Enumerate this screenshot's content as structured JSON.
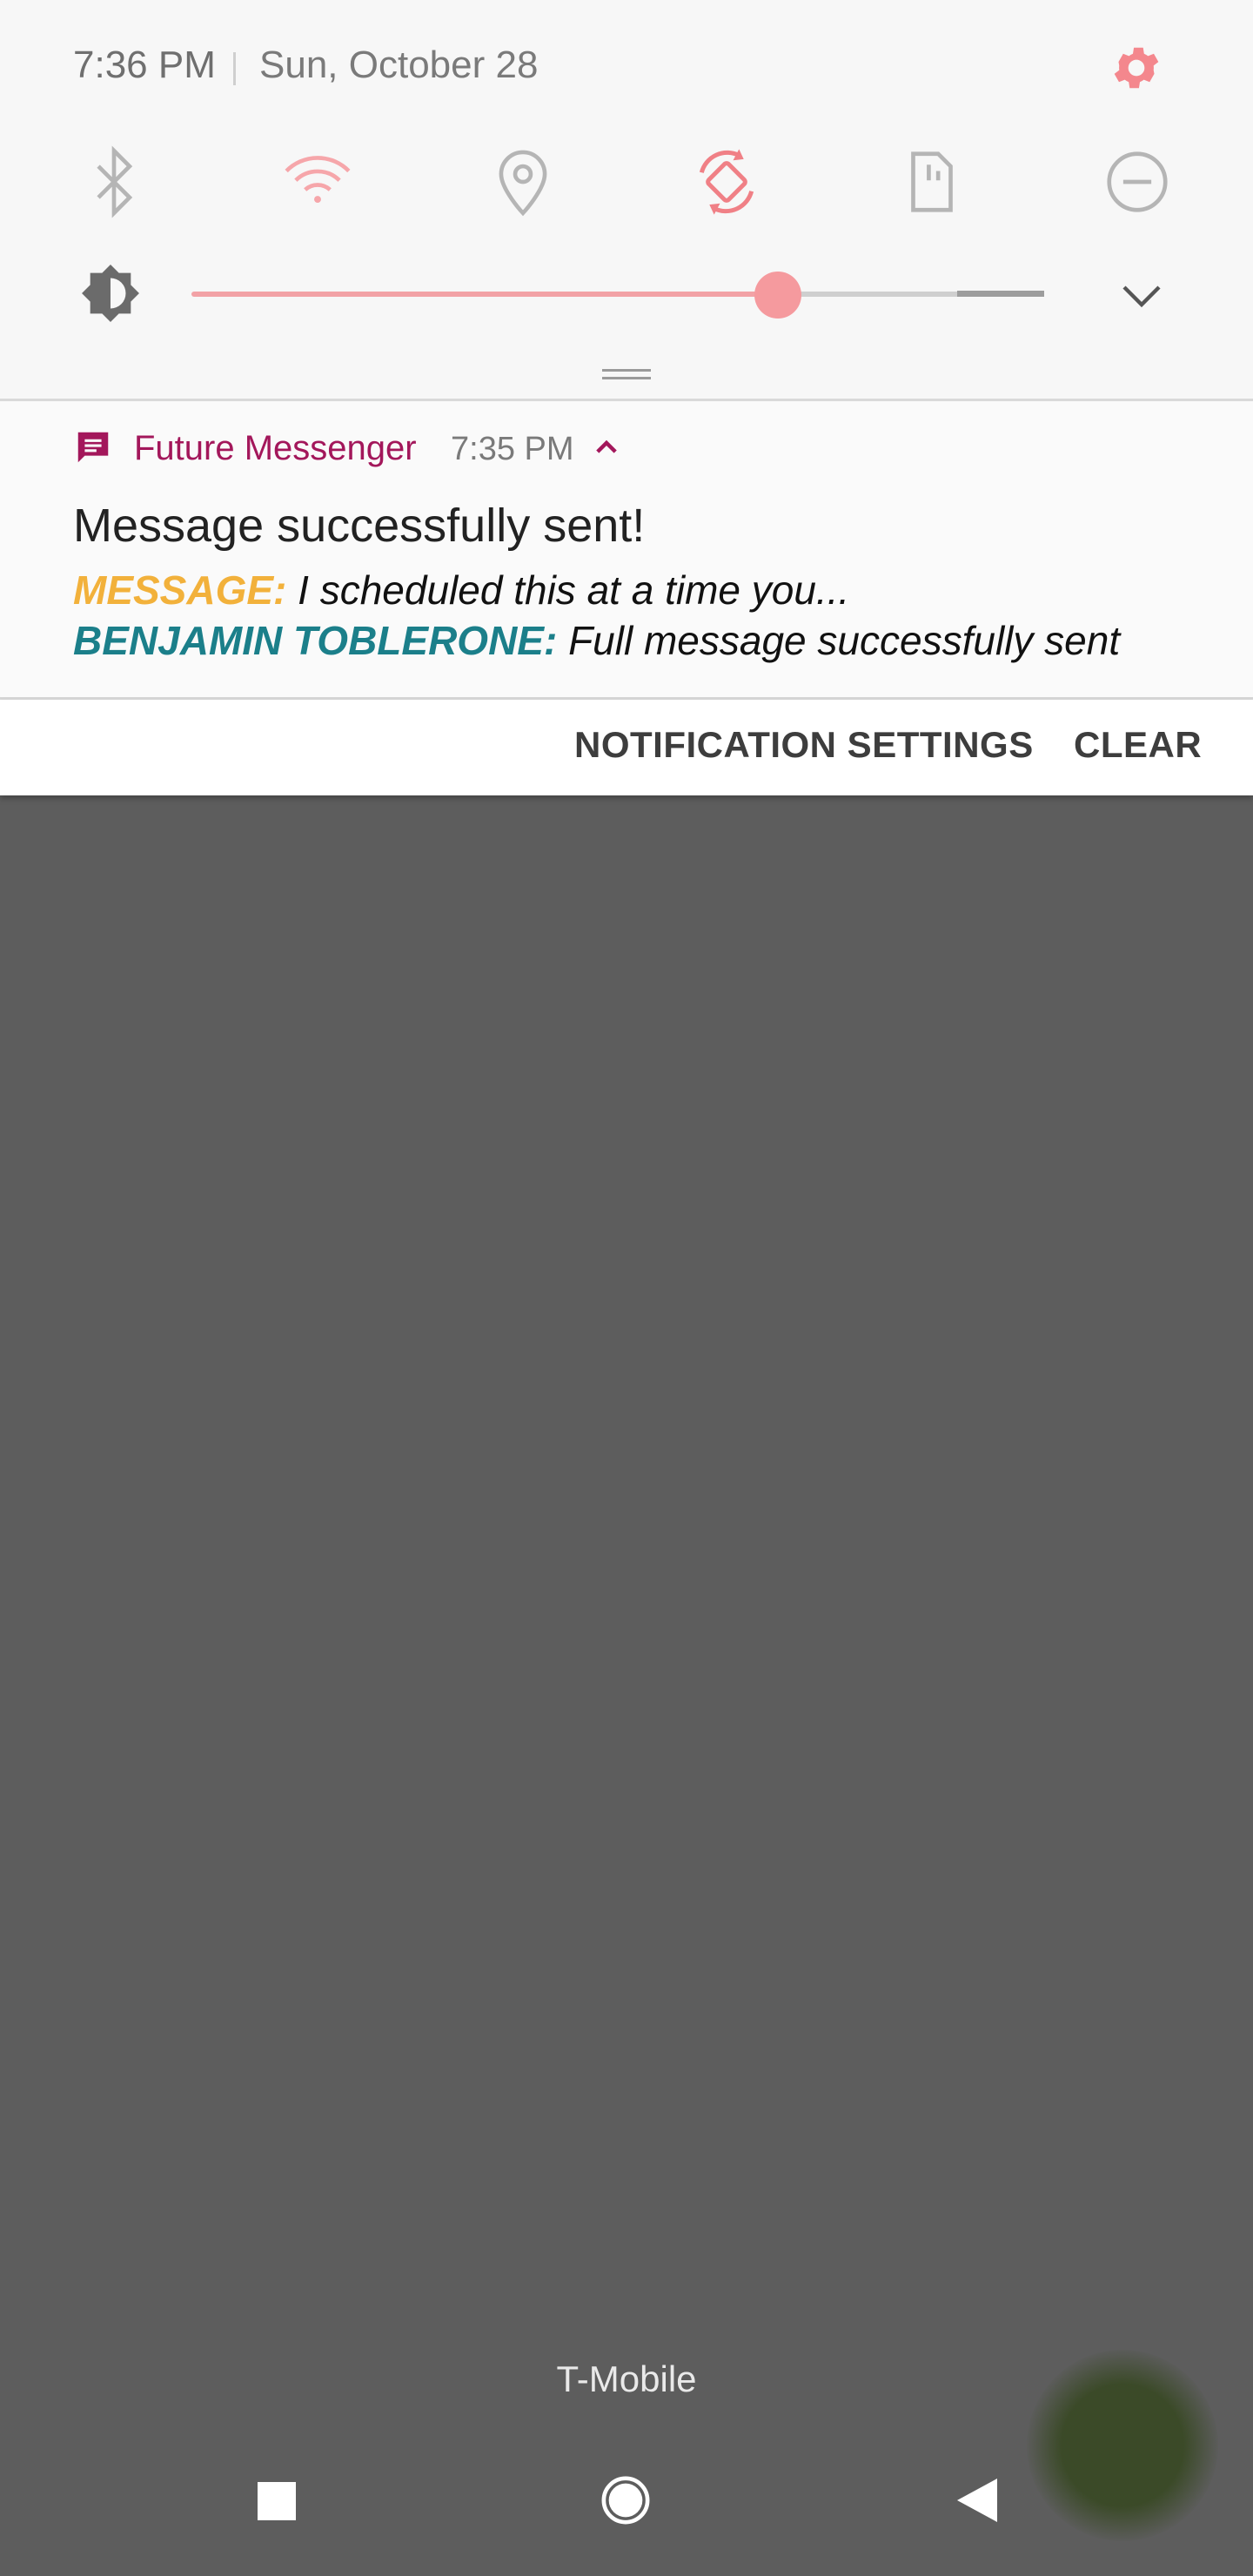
{
  "status": {
    "time": "7:36 PM",
    "date": "Sun, October 28"
  },
  "quick_settings": {
    "icons": [
      "bluetooth-icon",
      "wifi-icon",
      "location-icon",
      "auto-rotate-icon",
      "mobile-data-icon",
      "do-not-disturb-icon"
    ],
    "brightness_level_pct": 69
  },
  "colors": {
    "accent": "#f59a9e",
    "app_name": "#a3175b",
    "message_label": "#f2b13b",
    "sender_label": "#1b7f8a",
    "scrim": "#5d5d5d"
  },
  "notification": {
    "app_name": "Future Messenger",
    "time": "7:35 PM",
    "title": "Message successfully sent!",
    "lines": [
      {
        "label": "MESSAGE:",
        "text": " I scheduled this at a time you..."
      },
      {
        "label": "BENJAMIN TOBLERONE:",
        "text": " Full message successfully sent"
      }
    ]
  },
  "actions": {
    "settings_label": "NOTIFICATION SETTINGS",
    "clear_label": "CLEAR"
  },
  "carrier": "T-Mobile"
}
